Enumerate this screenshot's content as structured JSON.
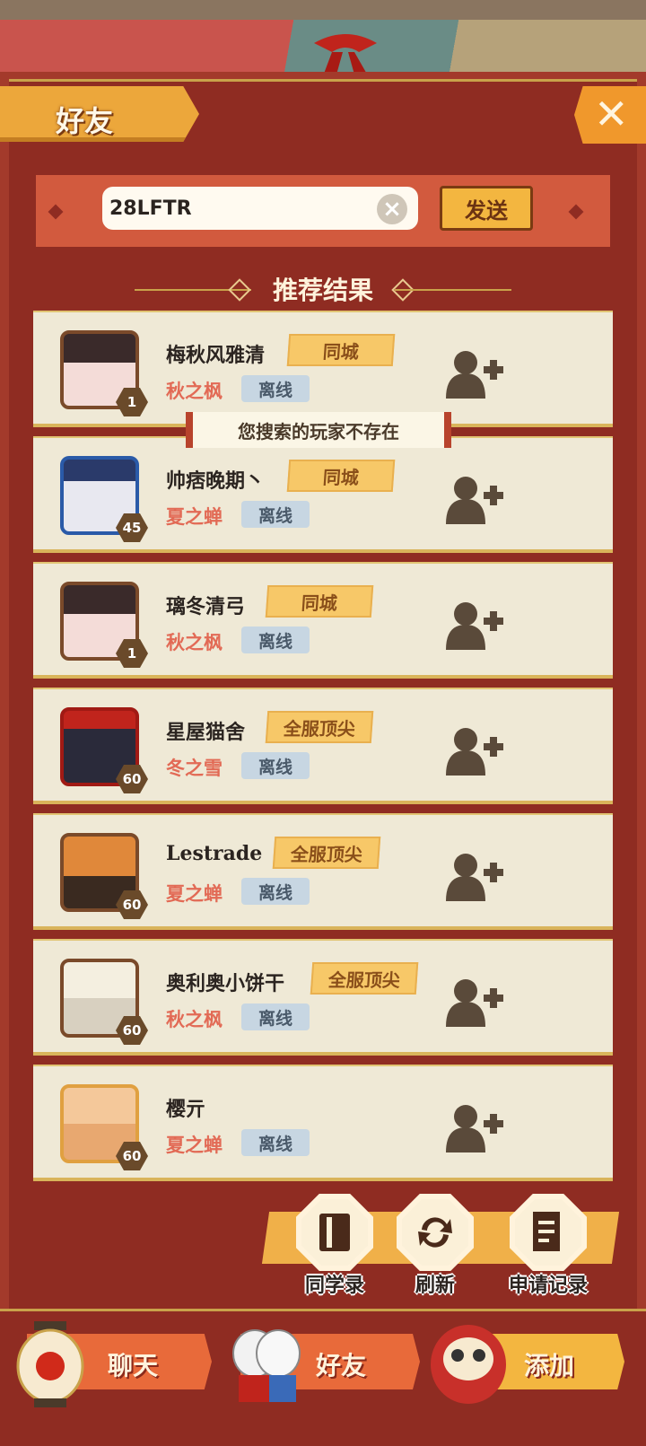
{
  "header": {
    "title": "好友",
    "close_icon": "close-icon"
  },
  "search": {
    "value": "28LFTR",
    "send_label": "发送"
  },
  "section_title": "推荐结果",
  "toast": "您搜索的玩家不存在",
  "players": [
    {
      "name": "梅秋风雅清",
      "server": "秋之枫",
      "status": "离线",
      "tag": "同城",
      "level": "1"
    },
    {
      "name": "帅痞晚期丶",
      "server": "夏之蝉",
      "status": "离线",
      "tag": "同城",
      "level": "45"
    },
    {
      "name": "璃冬清弓",
      "server": "秋之枫",
      "status": "离线",
      "tag": "同城",
      "level": "1"
    },
    {
      "name": "星屋猫舍",
      "server": "冬之雪",
      "status": "离线",
      "tag": "全服顶尖",
      "level": "60"
    },
    {
      "name": "Lestrade",
      "server": "夏之蝉",
      "status": "离线",
      "tag": "全服顶尖",
      "level": "60"
    },
    {
      "name": "奥利奥小饼干",
      "server": "秋之枫",
      "status": "离线",
      "tag": "全服顶尖",
      "level": "60"
    },
    {
      "name": "樱亓",
      "server": "夏之蝉",
      "status": "离线",
      "tag": "",
      "level": "60"
    }
  ],
  "actions": {
    "classmates": "同学录",
    "refresh": "刷新",
    "requests": "申请记录"
  },
  "bottom_tabs": {
    "chat": "聊天",
    "friends": "好友",
    "add": "添加"
  },
  "colors": {
    "accent": "#eca73b",
    "panel": "#a33a2b",
    "server_text": "#e26a55",
    "card": "#efe9d6"
  }
}
